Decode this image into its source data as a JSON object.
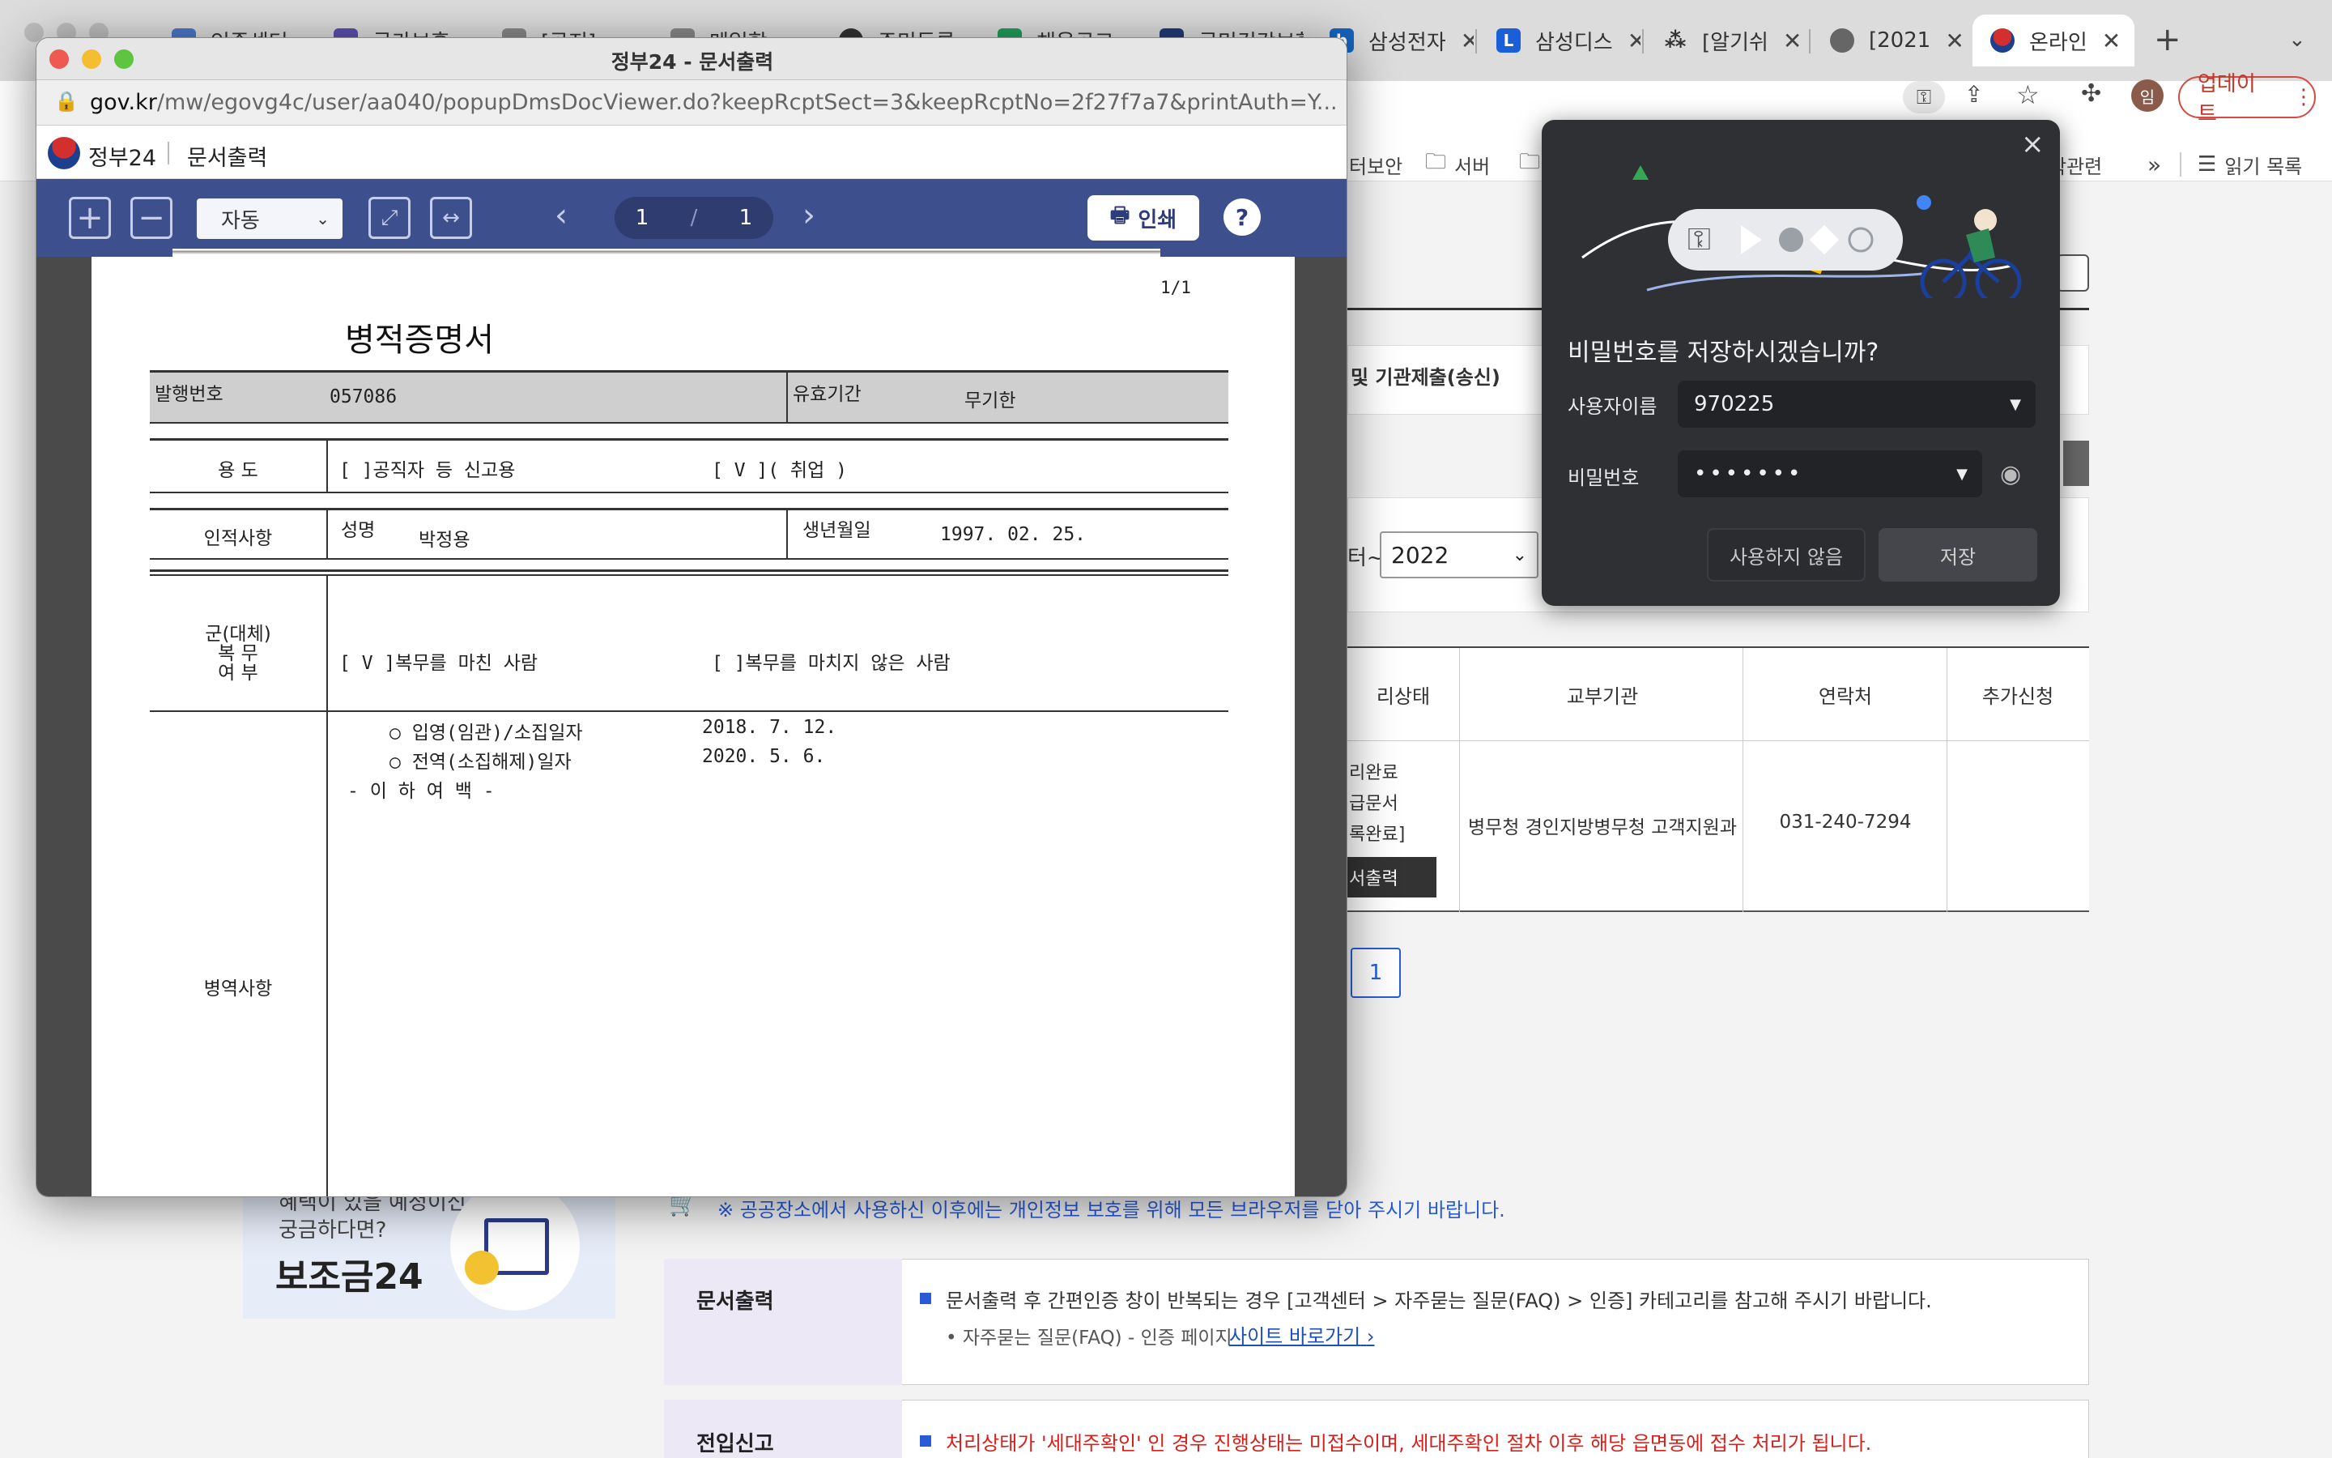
{
  "browser": {
    "tabs": [
      {
        "label": "인증센터"
      },
      {
        "label": "국가보훈"
      },
      {
        "label": "[공지]"
      },
      {
        "label": "메일함"
      },
      {
        "label": "주민등록"
      },
      {
        "label": "채용공고"
      },
      {
        "label": "국민건강보험"
      },
      {
        "label": "삼성전자"
      },
      {
        "label": "삼성디스"
      },
      {
        "label": "[알기쉬"
      },
      {
        "label": "[2021"
      },
      {
        "label": "온라인"
      }
    ],
    "new_tab": "+",
    "update_button": "업데이트",
    "profile_initial": "임",
    "bookmarks": [
      {
        "label": "터보안"
      },
      {
        "label": "서버"
      },
      {
        "label": "학관련"
      }
    ],
    "bookmark_overflow": "»",
    "reading_list": "읽기 목록"
  },
  "popup": {
    "window_title": "정부24 - 문서출력",
    "url_host": "gov.kr",
    "url_path": "/mw/egovg4c/user/aa040/popupDmsDocViewer.do?keepRcptSect=3&keepRcptNo=2f27f7a7&printAuth=Y...",
    "brand": "정부24",
    "brand_sub": "문서출력",
    "zoom_mode": "자동",
    "page_current": "1",
    "page_sep": "/",
    "page_total": "1",
    "print_label": "인쇄",
    "help_label": "?"
  },
  "document": {
    "page_indicator": "1/1",
    "title": "병적증명서",
    "issue_no_label": "발행번호",
    "issue_no": "057086",
    "valid_label": "유효기간",
    "valid_value": "무기한",
    "purpose_label": "용   도",
    "purpose_opt1": "[    ]공직자 등 신고용",
    "purpose_opt2": "[ V ]( 취업 )",
    "person_label": "인적사항",
    "name_label": "성명",
    "name_value": "박정용",
    "birth_label": "생년월일",
    "birth_value": "1997. 02. 25.",
    "service_label_1": "군(대체)",
    "service_label_2": "복   무",
    "service_label_3": "여   부",
    "service_opt1": "[ V ]복무를 마친 사람",
    "service_opt2": "[    ]복무를 마치지 않은 사람",
    "military_label": "병역사항",
    "enlist_label": "○ 입영(임관)/소집일자",
    "enlist_date": "2018. 7. 12.",
    "discharge_label": "○ 전역(소집해제)일자",
    "discharge_date": "2020. 5. 6.",
    "blank_note": "- 이 하 여 백 -"
  },
  "password_prompt": {
    "title": "비밀번호를 저장하시겠습니까?",
    "username_label": "사용자이름",
    "username_value": "970225",
    "password_label": "비밀번호",
    "password_value": "•••••••",
    "never_button": "사용하지 않음",
    "save_button": "저장",
    "close": "×"
  },
  "page": {
    "submit_heading": "및 기관제출(송신)",
    "year_prefix": "터~",
    "year_value": "2022",
    "table_headers": [
      "리상태",
      "교부기관",
      "연락처",
      "추가신청"
    ],
    "status_lines": [
      "리완료",
      "급문서",
      "록완료]"
    ],
    "status_button": "서출력",
    "issuer": "병무청 경인지방병무청 고객지원과",
    "phone": "031-240-7294",
    "pagination": "1",
    "notice": "※ 공공장소에서 사용하신 이후에는 개인정보 보호를 위해 모든 브라우저를 닫아 주시기 바랍니다.",
    "banner_line1": "혜택이 있을 예정이신",
    "banner_line2": "궁금하다면?",
    "banner_title": "보조금24",
    "info": [
      {
        "title": "문서출력",
        "text": "문서출력 후 간편인증 창이 반복되는 경우 [고객센터 > 자주묻는 질문(FAQ) > 인증] 카테고리를 참고해 주시기 바랍니다.",
        "sub": "자주묻는 질문(FAQ) - 인증 페이지",
        "link": "사이트 바로가기"
      },
      {
        "title": "전입신고",
        "text": "처리상태가 '세대주확인' 인 경우 진행상태는 미접수이며, 세대주확인 절차 이후 해당 읍면동에 접수 처리가 됩니다."
      }
    ]
  },
  "colors": {
    "viewer_toolbar": "#3e4f8e",
    "link_blue": "#1f4fb8",
    "notice_blue": "#2a5bd7",
    "warn_red": "#d6201b",
    "info_label_bg": "#ece8f6",
    "pw_bg": "#2f3034"
  }
}
